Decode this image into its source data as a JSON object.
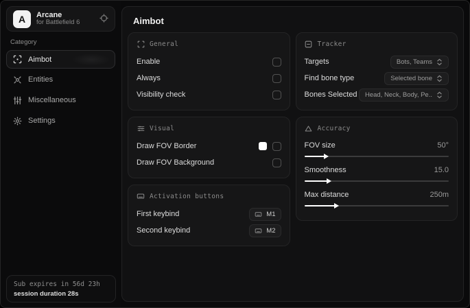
{
  "window": {
    "bg": "#0a0a0b",
    "accent": "#ffffff"
  },
  "sidebar": {
    "logo_letter": "A",
    "app_name": "Arcane",
    "app_subtitle": "for Battlefield 6",
    "header_icon": "refresh-target-icon",
    "category_label": "Category",
    "items": [
      {
        "label": "Aimbot",
        "icon": "crosshair-icon",
        "selected": true
      },
      {
        "label": "Entities",
        "icon": "entities-icon",
        "selected": false
      },
      {
        "label": "Miscellaneous",
        "icon": "sliders-vertical-icon",
        "selected": false
      },
      {
        "label": "Settings",
        "icon": "gear-icon",
        "selected": false
      }
    ],
    "sub_expires": "Sub expires in 56d 23h",
    "session_duration": "session duration 28s"
  },
  "main": {
    "title": "Aimbot",
    "general": {
      "title": "General",
      "icon": "scan-frame-icon",
      "rows": [
        {
          "label": "Enable",
          "control": "checkbox",
          "checked": false
        },
        {
          "label": "Always",
          "control": "checkbox",
          "checked": false
        },
        {
          "label": "Visibility check",
          "control": "checkbox",
          "checked": false
        }
      ]
    },
    "visual": {
      "title": "Visual",
      "icon": "sliders-horizontal-icon",
      "rows": [
        {
          "label": "Draw FOV Border",
          "control": "swatch+checkbox",
          "swatch_color": "#ffffff",
          "checked": false
        },
        {
          "label": "Draw FOV Background",
          "control": "checkbox",
          "checked": false
        }
      ]
    },
    "activation": {
      "title": "Activation buttons",
      "icon": "keyboard-icon",
      "rows": [
        {
          "label": "First keybind",
          "key": "M1"
        },
        {
          "label": "Second keybind",
          "key": "M2"
        }
      ]
    },
    "tracker": {
      "title": "Tracker",
      "icon": "square-minus-icon",
      "rows": [
        {
          "label": "Targets",
          "value": "Bots, Teams"
        },
        {
          "label": "Find bone type",
          "value": "Selected bone"
        },
        {
          "label": "Bones Selected",
          "value": "Head, Neck, Body, Pe.."
        }
      ]
    },
    "accuracy": {
      "title": "Accuracy",
      "icon": "triangle-icon",
      "rows": [
        {
          "label": "FOV size",
          "value": "50°",
          "percent": 14
        },
        {
          "label": "Smoothness",
          "value": "15.0",
          "percent": 16
        },
        {
          "label": "Max distance",
          "value": "250m",
          "percent": 21
        }
      ]
    }
  }
}
